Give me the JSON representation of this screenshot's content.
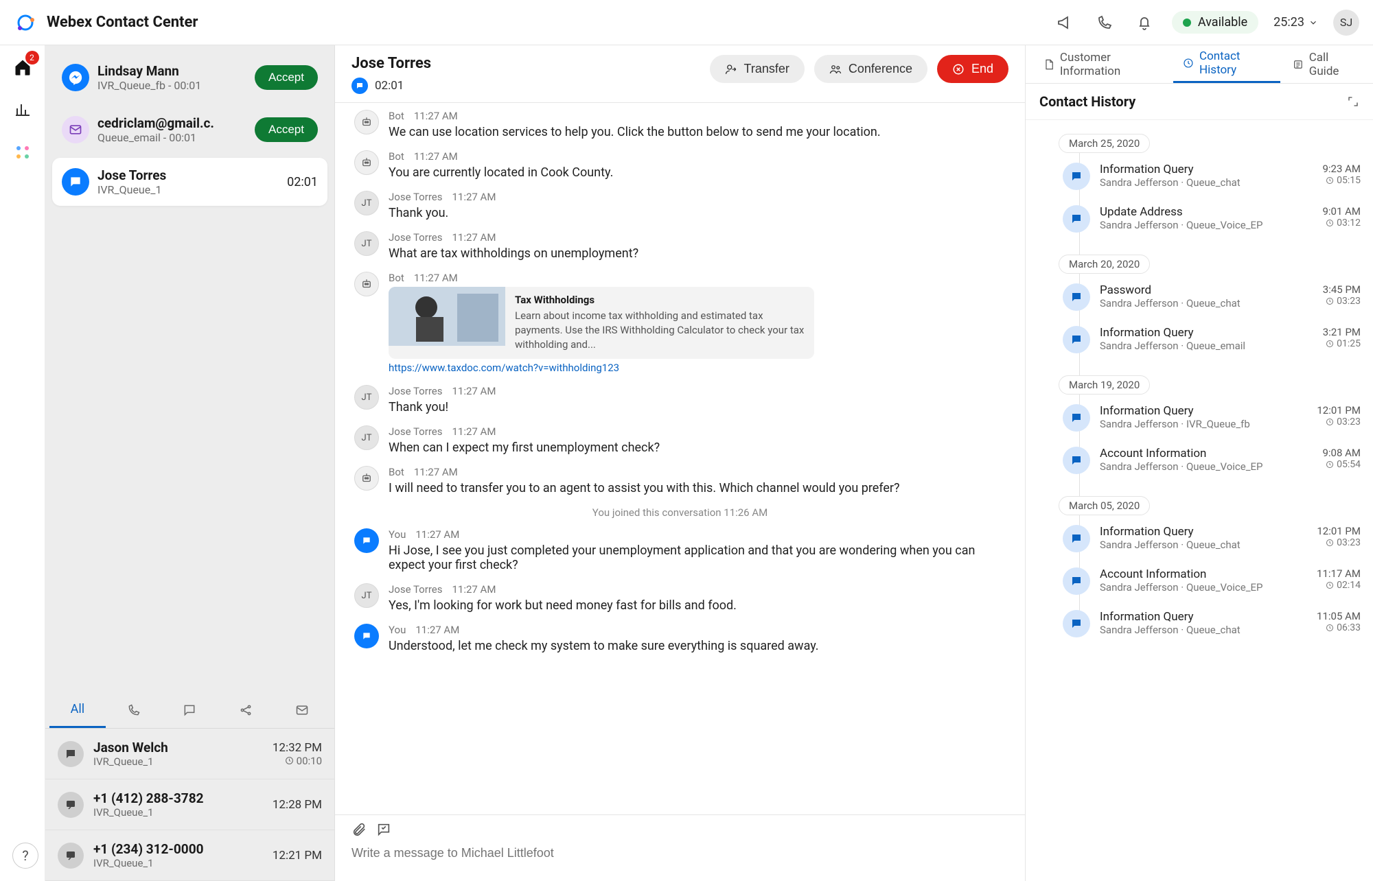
{
  "header": {
    "app_title": "Webex Contact Center",
    "status_label": "Available",
    "session_timer": "25:23",
    "agent_initials": "SJ"
  },
  "nav": {
    "home_badge": "2"
  },
  "incoming": [
    {
      "channel": "fb",
      "name": "Lindsay Mann",
      "sub": "IVR_Queue_fb - 00:01",
      "accept": "Accept"
    },
    {
      "channel": "email",
      "name": "cedriclam@gmail.c.",
      "sub": "Queue_email - 00:01",
      "accept": "Accept"
    },
    {
      "channel": "chat",
      "name": "Jose Torres",
      "sub": "IVR_Queue_1",
      "timer": "02:01",
      "active": true
    }
  ],
  "contact_tabs": {
    "all_label": "All"
  },
  "recent_contacts": [
    {
      "name": "Jason Welch",
      "sub": "IVR_Queue_1",
      "time": "12:32 PM",
      "dur": "00:10"
    },
    {
      "name": "+1 (412) 288-3782",
      "sub": "IVR_Queue_1",
      "time": "12:28 PM"
    },
    {
      "name": "+1 (234) 312-0000",
      "sub": "IVR_Queue_1",
      "time": "12:21 PM"
    }
  ],
  "conversation": {
    "title": "Jose Torres",
    "timer": "02:01",
    "actions": {
      "transfer": "Transfer",
      "conference": "Conference",
      "end": "End"
    },
    "messages": [
      {
        "who": "bot",
        "name": "Bot",
        "time": "11:27 AM",
        "text": "We can use location services to help you.  Click the button below to send me your location."
      },
      {
        "who": "bot",
        "name": "Bot",
        "time": "11:27 AM",
        "text": "You are currently located in Cook County."
      },
      {
        "who": "jt",
        "name": "Jose Torres",
        "time": "11:27 AM",
        "text": "Thank you."
      },
      {
        "who": "jt",
        "name": "Jose Torres",
        "time": "11:27 AM",
        "text": "What are tax withholdings on unemployment?"
      },
      {
        "who": "bot",
        "name": "Bot",
        "time": "11:27 AM",
        "card": {
          "title": "Tax Withholdings",
          "desc": "Learn about income tax withholding and estimated tax payments. Use the IRS Withholding Calculator to check your tax withholding and...",
          "link": "https://www.taxdoc.com/watch?v=withholding123"
        }
      },
      {
        "who": "jt",
        "name": "Jose Torres",
        "time": "11:27 AM",
        "text": "Thank you!"
      },
      {
        "who": "jt",
        "name": "Jose Torres",
        "time": "11:27 AM",
        "text": "When can I expect my first unemployment check?"
      },
      {
        "who": "bot",
        "name": "Bot",
        "time": "11:27 AM",
        "text": "I will need to transfer you to an agent to assist you with this.  Which channel would you prefer?"
      },
      {
        "sys": true,
        "text": "You joined this conversation",
        "time": "11:26 AM"
      },
      {
        "who": "you",
        "name": "You",
        "time": "11:27 AM",
        "text": "Hi Jose, I see you just completed your unemployment application and that you are wondering when you can expect your first check?"
      },
      {
        "who": "jt",
        "name": "Jose Torres",
        "time": "11:27 AM",
        "text": "Yes, I'm looking for work but need money fast for bills and food."
      },
      {
        "who": "you",
        "name": "You",
        "time": "11:27 AM",
        "text": "Understood, let me check my system to make sure everything is squared away."
      }
    ],
    "compose_placeholder": "Write a message to Michael Littlefoot"
  },
  "right": {
    "tabs": {
      "customer_info": "Customer Information",
      "contact_history": "Contact History",
      "call_guide": "Call Guide"
    },
    "panel_title": "Contact History",
    "groups": [
      {
        "date": "March 25, 2020",
        "events": [
          {
            "title": "Information Query",
            "sub": "Sandra Jefferson · Queue_chat",
            "time": "9:23 AM",
            "dur": "05:15"
          },
          {
            "title": "Update Address",
            "sub": "Sandra Jefferson · Queue_Voice_EP",
            "time": "9:01 AM",
            "dur": "03:12"
          }
        ]
      },
      {
        "date": "March 20, 2020",
        "events": [
          {
            "title": "Password",
            "sub": "Sandra Jefferson · Queue_chat",
            "time": "3:45 PM",
            "dur": "03:23"
          },
          {
            "title": "Information Query",
            "sub": "Sandra Jefferson · Queue_email",
            "time": "3:21 PM",
            "dur": "01:25"
          }
        ]
      },
      {
        "date": "March 19, 2020",
        "events": [
          {
            "title": "Information Query",
            "sub": "Sandra Jefferson · IVR_Queue_fb",
            "time": "12:01 PM",
            "dur": "03:23"
          },
          {
            "title": "Account Information",
            "sub": "Sandra Jefferson · Queue_Voice_EP",
            "time": "9:08 AM",
            "dur": "05:54"
          }
        ]
      },
      {
        "date": "March 05, 2020",
        "events": [
          {
            "title": "Information Query",
            "sub": "Sandra Jefferson · Queue_chat",
            "time": "12:01 PM",
            "dur": "03:23"
          },
          {
            "title": "Account Information",
            "sub": "Sandra Jefferson · Queue_Voice_EP",
            "time": "11:17 AM",
            "dur": "02:14"
          },
          {
            "title": "Information Query",
            "sub": "Sandra Jefferson · Queue_chat",
            "time": "11:05 AM",
            "dur": "06:33"
          }
        ]
      }
    ]
  }
}
